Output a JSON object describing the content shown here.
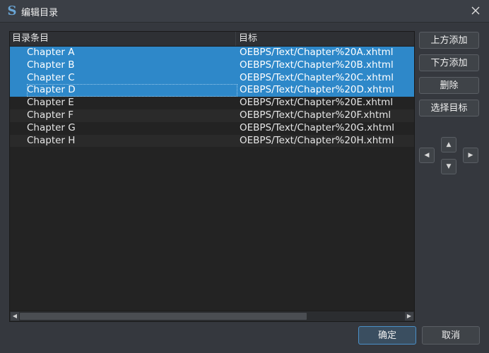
{
  "window": {
    "title": "编辑目录",
    "app_icon_glyph": "S",
    "icons": {
      "app": "sigil-app-icon",
      "close": "close-icon"
    }
  },
  "toc_table": {
    "columns": [
      "目录条目",
      "目标"
    ],
    "rows": [
      {
        "entry": "Chapter A",
        "target": "OEBPS/Text/Chapter%20A.xhtml",
        "selected": true
      },
      {
        "entry": "Chapter B",
        "target": "OEBPS/Text/Chapter%20B.xhtml",
        "selected": true
      },
      {
        "entry": "Chapter C",
        "target": "OEBPS/Text/Chapter%20C.xhtml",
        "selected": true
      },
      {
        "entry": "Chapter D",
        "target": "OEBPS/Text/Chapter%20D.xhtml",
        "selected": true
      },
      {
        "entry": "Chapter E",
        "target": "OEBPS/Text/Chapter%20E.xhtml",
        "selected": false
      },
      {
        "entry": "Chapter F",
        "target": "OEBPS/Text/Chapter%20F.xhtml",
        "selected": false
      },
      {
        "entry": "Chapter G",
        "target": "OEBPS/Text/Chapter%20G.xhtml",
        "selected": false
      },
      {
        "entry": "Chapter H",
        "target": "OEBPS/Text/Chapter%20H.xhtml",
        "selected": false
      }
    ]
  },
  "side_buttons": {
    "add_above": "上方添加",
    "add_below": "下方添加",
    "delete": "删除",
    "select_target": "选择目标"
  },
  "arrows": {
    "up": "▲",
    "down": "▼",
    "left": "◀",
    "right": "▶"
  },
  "footer": {
    "ok": "确定",
    "cancel": "取消"
  },
  "colors": {
    "selection": "#2e88c9",
    "background": "#35383e",
    "panel": "#232323"
  }
}
